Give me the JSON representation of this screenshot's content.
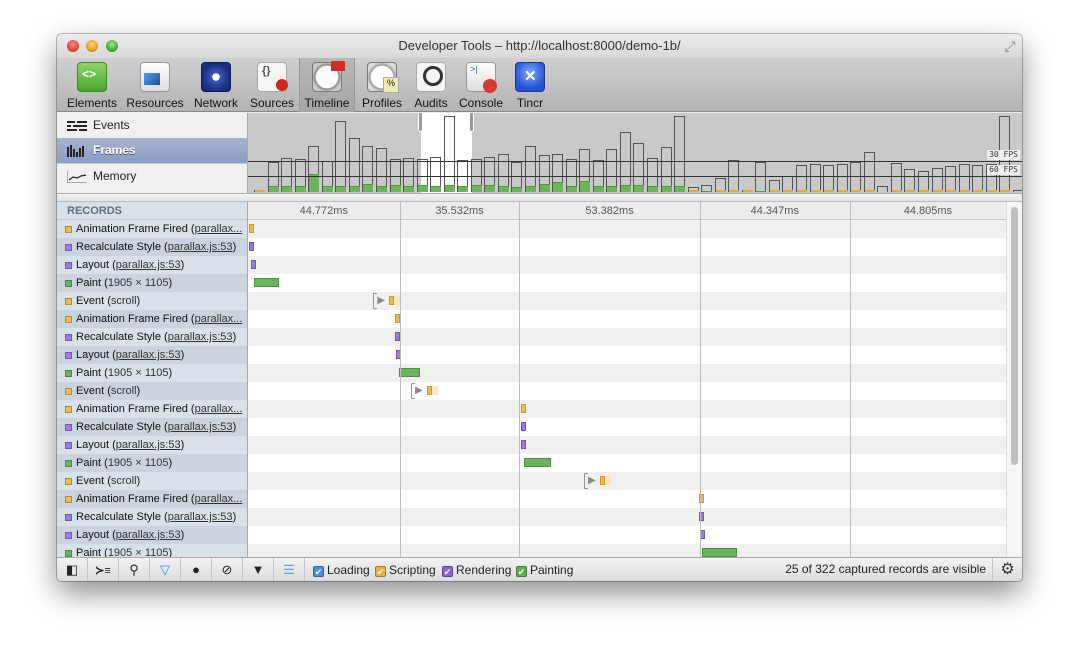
{
  "window": {
    "title": "Developer Tools – http://localhost:8000/demo-1b/"
  },
  "toolbar": {
    "tabs": [
      {
        "label": "Elements",
        "icon": "elements-icon"
      },
      {
        "label": "Resources",
        "icon": "resources-icon"
      },
      {
        "label": "Network",
        "icon": "network-icon"
      },
      {
        "label": "Sources",
        "icon": "sources-icon"
      },
      {
        "label": "Timeline",
        "icon": "timeline-icon",
        "active": true
      },
      {
        "label": "Profiles",
        "icon": "profiles-icon"
      },
      {
        "label": "Audits",
        "icon": "audits-icon"
      },
      {
        "label": "Console",
        "icon": "console-icon"
      },
      {
        "label": "Tincr",
        "icon": "tincr-icon"
      }
    ]
  },
  "overview": {
    "modes": [
      {
        "label": "Events",
        "icon": "events-icon"
      },
      {
        "label": "Frames",
        "icon": "frames-icon",
        "selected": true
      },
      {
        "label": "Memory",
        "icon": "memory-icon"
      }
    ],
    "fps_labels": {
      "fps30": "30 FPS",
      "fps60": "60 FPS"
    },
    "selection_frames": [
      12,
      16
    ],
    "frames": [
      {
        "ms": 1,
        "paint_ms": 0,
        "script": true
      },
      {
        "ms": 32,
        "paint_ms": 6
      },
      {
        "ms": 37,
        "paint_ms": 7
      },
      {
        "ms": 36,
        "paint_ms": 7
      },
      {
        "ms": 49,
        "paint_ms": 19
      },
      {
        "ms": 33,
        "paint_ms": 6
      },
      {
        "ms": 76,
        "paint_ms": 7
      },
      {
        "ms": 58,
        "paint_ms": 7
      },
      {
        "ms": 50,
        "paint_ms": 9
      },
      {
        "ms": 47,
        "paint_ms": 7
      },
      {
        "ms": 36,
        "paint_ms": 8
      },
      {
        "ms": 37,
        "paint_ms": 7
      },
      {
        "ms": 36,
        "paint_ms": 8
      },
      {
        "ms": 38,
        "paint_ms": 7
      },
      {
        "ms": 82,
        "paint_ms": 8
      },
      {
        "ms": 34,
        "paint_ms": 6
      },
      {
        "ms": 36,
        "paint_ms": 8
      },
      {
        "ms": 38,
        "paint_ms": 8
      },
      {
        "ms": 41,
        "paint_ms": 7
      },
      {
        "ms": 32,
        "paint_ms": 5
      },
      {
        "ms": 49,
        "paint_ms": 7
      },
      {
        "ms": 40,
        "paint_ms": 9
      },
      {
        "ms": 41,
        "paint_ms": 11
      },
      {
        "ms": 36,
        "paint_ms": 7
      },
      {
        "ms": 46,
        "paint_ms": 12
      },
      {
        "ms": 34,
        "paint_ms": 6
      },
      {
        "ms": 46,
        "paint_ms": 6
      },
      {
        "ms": 64,
        "paint_ms": 8
      },
      {
        "ms": 53,
        "paint_ms": 8
      },
      {
        "ms": 37,
        "paint_ms": 7
      },
      {
        "ms": 48,
        "paint_ms": 7
      },
      {
        "ms": 82,
        "paint_ms": 7
      },
      {
        "ms": 5,
        "paint_ms": 0,
        "script": true
      },
      {
        "ms": 8,
        "paint_ms": 1
      },
      {
        "ms": 15,
        "paint_ms": 0,
        "script": true
      },
      {
        "ms": 34,
        "paint_ms": 0,
        "script": true
      },
      {
        "ms": 2,
        "paint_ms": 0,
        "script": true
      },
      {
        "ms": 32,
        "paint_ms": 1
      },
      {
        "ms": 13,
        "paint_ms": 0,
        "script": true
      },
      {
        "ms": 17,
        "paint_ms": 0,
        "script": true
      },
      {
        "ms": 29,
        "paint_ms": 0,
        "script": true
      },
      {
        "ms": 30,
        "paint_ms": 0,
        "script": true
      },
      {
        "ms": 29,
        "paint_ms": 0,
        "script": true
      },
      {
        "ms": 30,
        "paint_ms": 0,
        "script": true
      },
      {
        "ms": 32,
        "paint_ms": 0,
        "script": true
      },
      {
        "ms": 43,
        "paint_ms": 0,
        "script": true
      },
      {
        "ms": 6,
        "paint_ms": 0
      },
      {
        "ms": 31,
        "paint_ms": 0,
        "script": true
      },
      {
        "ms": 25,
        "paint_ms": 0,
        "script": true
      },
      {
        "ms": 23,
        "paint_ms": 0,
        "script": true
      },
      {
        "ms": 26,
        "paint_ms": 0,
        "script": true
      },
      {
        "ms": 28,
        "paint_ms": 0,
        "script": true
      },
      {
        "ms": 30,
        "paint_ms": 0,
        "script": true
      },
      {
        "ms": 29,
        "paint_ms": 0,
        "script": true
      },
      {
        "ms": 30,
        "paint_ms": 0,
        "script": true
      },
      {
        "ms": 82,
        "paint_ms": 0,
        "script": true
      },
      {
        "ms": 1,
        "paint_ms": 0
      }
    ]
  },
  "records": {
    "header": "RECORDS",
    "items": [
      {
        "type": "scripting",
        "name": "Animation Frame Fired",
        "detail": "parallax...",
        "link": true,
        "start": 0.0,
        "dur": 0.4
      },
      {
        "type": "rendering",
        "name": "Recalculate Style",
        "detail": "parallax.js:53",
        "link": true,
        "start": 0.05,
        "dur": 0.4
      },
      {
        "type": "rendering",
        "name": "Layout",
        "detail": "parallax.js:53",
        "link": true,
        "start": 0.2,
        "dur": 0.4
      },
      {
        "type": "painting",
        "name": "Paint",
        "detail": "1905 × 1105",
        "link": false,
        "start": 0.6,
        "dur": 3.4
      },
      {
        "type": "scripting",
        "name": "Event",
        "detail": "scroll",
        "link": false,
        "start": 18.5,
        "dur": 0.5,
        "expandable": true
      },
      {
        "type": "scripting",
        "name": "Animation Frame Fired",
        "detail": "parallax...",
        "link": true,
        "start": 19.2,
        "dur": 0.4
      },
      {
        "type": "rendering",
        "name": "Recalculate Style",
        "detail": "parallax.js:53",
        "link": true,
        "start": 19.3,
        "dur": 0.4
      },
      {
        "type": "rendering",
        "name": "Layout",
        "detail": "parallax.js:53",
        "link": true,
        "start": 19.4,
        "dur": 0.4
      },
      {
        "type": "painting",
        "name": "Paint",
        "detail": "1905 × 1105",
        "link": false,
        "start": 19.8,
        "dur": 2.8
      },
      {
        "type": "scripting",
        "name": "Event",
        "detail": "scroll",
        "link": false,
        "start": 23.5,
        "dur": 0.5,
        "expandable": true
      },
      {
        "type": "scripting",
        "name": "Animation Frame Fired",
        "detail": "parallax...",
        "link": true,
        "start": 35.9,
        "dur": 0.4
      },
      {
        "type": "rendering",
        "name": "Recalculate Style",
        "detail": "parallax.js:53",
        "link": true,
        "start": 35.9,
        "dur": 0.4
      },
      {
        "type": "rendering",
        "name": "Layout",
        "detail": "parallax.js:53",
        "link": true,
        "start": 35.9,
        "dur": 0.4
      },
      {
        "type": "painting",
        "name": "Paint",
        "detail": "1905 × 1105",
        "link": false,
        "start": 36.3,
        "dur": 3.5
      },
      {
        "type": "scripting",
        "name": "Event",
        "detail": "scroll",
        "link": false,
        "start": 46.3,
        "dur": 0.5,
        "expandable": true
      },
      {
        "type": "scripting",
        "name": "Animation Frame Fired",
        "detail": "parallax...",
        "link": true,
        "start": 59.4,
        "dur": 0.4
      },
      {
        "type": "rendering",
        "name": "Recalculate Style",
        "detail": "parallax.js:53",
        "link": true,
        "start": 59.4,
        "dur": 0.4
      },
      {
        "type": "rendering",
        "name": "Layout",
        "detail": "parallax.js:53",
        "link": true,
        "start": 59.5,
        "dur": 0.4
      },
      {
        "type": "painting",
        "name": "Paint",
        "detail": "1905 × 1105",
        "link": false,
        "start": 59.7,
        "dur": 4.7
      }
    ]
  },
  "timeline": {
    "frame_durations": [
      "44.772ms",
      "35.532ms",
      "53.382ms",
      "44.347ms",
      "44.805ms"
    ],
    "frame_boundaries": [
      0,
      20.0,
      35.8,
      59.6,
      79.4,
      100
    ]
  },
  "statusbar": {
    "buttons": [
      {
        "name": "dock-toggle-button",
        "glyph": "◧"
      },
      {
        "name": "console-drawer-button",
        "glyph": "≻≡"
      },
      {
        "name": "search-button",
        "glyph": "⚲"
      },
      {
        "name": "filter-button",
        "glyph": "▽"
      },
      {
        "name": "record-button",
        "glyph": "●"
      },
      {
        "name": "clear-button",
        "glyph": "⊘"
      },
      {
        "name": "garbage-collect-button",
        "glyph": "▼"
      },
      {
        "name": "glue-records-button",
        "glyph": "☰"
      }
    ],
    "filters": [
      {
        "label": "Loading",
        "color": "#4a8fdd",
        "checked": true
      },
      {
        "label": "Scripting",
        "color": "#e8b23a",
        "checked": true
      },
      {
        "label": "Rendering",
        "color": "#8a63d8",
        "checked": true
      },
      {
        "label": "Painting",
        "color": "#5fae4f",
        "checked": true
      }
    ],
    "status": "25 of 322 captured records are visible"
  },
  "colors": {
    "loading": "#5b94dc",
    "scripting": "#f0bd45",
    "rendering": "#9c7ae8",
    "painting": "#6db25f",
    "frames_selected": "#8a9cc0"
  }
}
